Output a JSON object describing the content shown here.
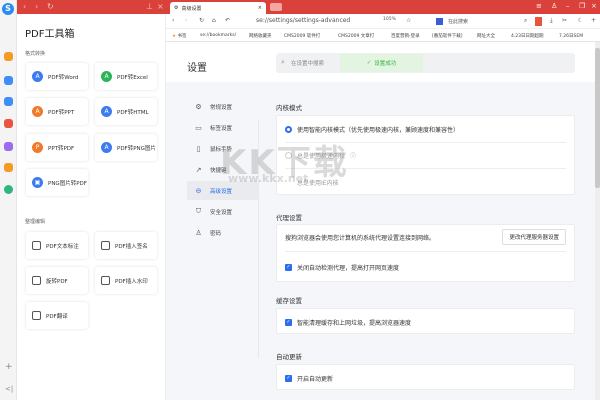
{
  "toolbox": {
    "title": "PDF工具箱",
    "section1": "格式转换",
    "section2": "整理编辑",
    "convert": [
      "PDF转Word",
      "PDF转Excel",
      "PDF转PPT",
      "PDF转HTML",
      "PPT转PDF",
      "PDF转PNG图片",
      "PNG图片转PDF"
    ],
    "edit": [
      "PDF文本标注",
      "PDF插入签名",
      "旋转PDF",
      "PDF插入水印",
      "PDF翻译"
    ]
  },
  "browser": {
    "tab_title": "高级设置",
    "url": "se://settings/settings-advanced",
    "zoom": "105%",
    "search_placeholder": "在此搜索",
    "bookmarks": [
      "书签",
      "se://bookmarks/",
      "网络收藏夹",
      "CMS2009 软件打",
      "CMS2009 文章打",
      "百度营销-登录",
      "[番茄软件下载]",
      "网址大全",
      "4.23日日期超期",
      "7.26日SEM"
    ]
  },
  "settings": {
    "title": "设置",
    "search_placeholder": "在设置中搜索",
    "saved": "设置成功",
    "nav": [
      "常规设置",
      "标签设置",
      "鼠标手势",
      "快捷键",
      "高级设置",
      "安全设置",
      "密码"
    ],
    "kernel": {
      "heading": "内核模式",
      "options": [
        "使用智能内核模式（优先使用极速内核，兼顾速度和兼容性）",
        "总是使用极速内核",
        "总是使用IE内核"
      ]
    },
    "proxy": {
      "heading": "代理设置",
      "desc": "搜狗浏览器会使用您计算机的系统代理设置连接到网络。",
      "button": "更改代理服务器设置",
      "option": "关闭自动检测代理，提高打开网页速度"
    },
    "cache": {
      "heading": "缓存设置",
      "option": "智能清理缓存和上网垃圾，提高浏览器速度"
    },
    "update": {
      "heading": "自动更新",
      "option": "开启自动更新"
    }
  },
  "watermark": {
    "text": "KK下载",
    "url": "www.kkx.net"
  },
  "colors": {
    "accent": "#2b6cf0",
    "brand": "#d9413a",
    "success": "#3cb043"
  }
}
